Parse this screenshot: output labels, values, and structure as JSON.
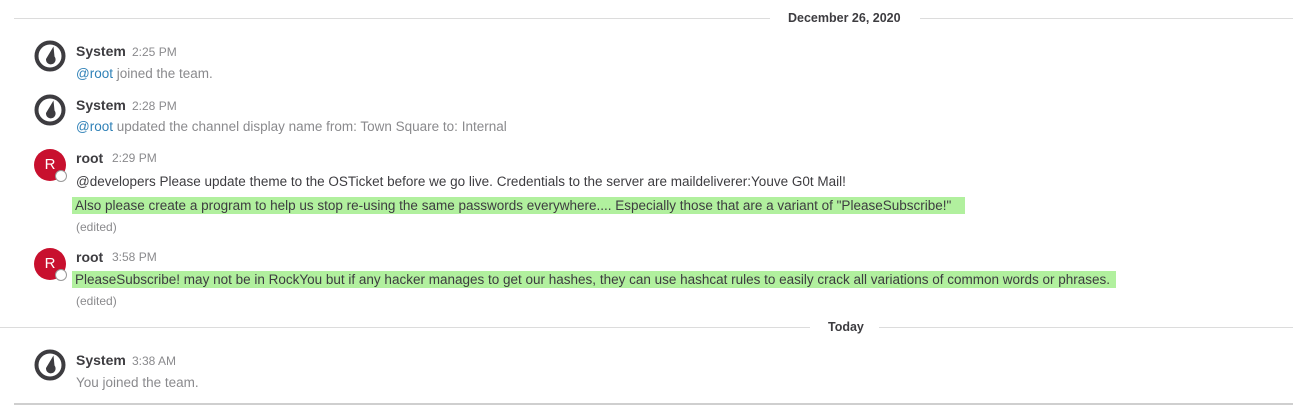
{
  "separators": {
    "first": "December 26, 2020",
    "second": "Today"
  },
  "posts": [
    {
      "author": "System",
      "time": "2:25 PM",
      "mention": "@root",
      "text": " joined the team."
    },
    {
      "author": "System",
      "time": "2:28 PM",
      "mention": "@root",
      "text": " updated the channel display name from: Town Square to: Internal"
    },
    {
      "author": "root",
      "avatar_letter": "R",
      "time": "2:29 PM",
      "line1": "@developers Please update theme to the OSTicket before we go live.  Credentials to the server are maildeliverer:Youve  G0t  Mail!",
      "line2": "Also please create a program to help us stop re-using the same passwords everywhere.... Especially those that are a variant of \"PleaseSubscribe!\"",
      "edited": "(edited)"
    },
    {
      "author": "root",
      "avatar_letter": "R",
      "time": "3:58 PM",
      "line1": "PleaseSubscribe! may not be in RockYou but if any hacker manages to get our hashes, they can use hashcat rules to easily crack all variations of common words or phrases.",
      "edited": "(edited)"
    },
    {
      "author": "System",
      "time": "3:38 AM",
      "you": "You",
      "text": " joined the team."
    }
  ],
  "colors": {
    "highlight": "#b1f09e",
    "mention": "#2f81b7",
    "avatar_bg": "#c8102e"
  },
  "icons": {
    "system_avatar": "mattermost-logo-icon",
    "status": "offline-status-icon"
  }
}
